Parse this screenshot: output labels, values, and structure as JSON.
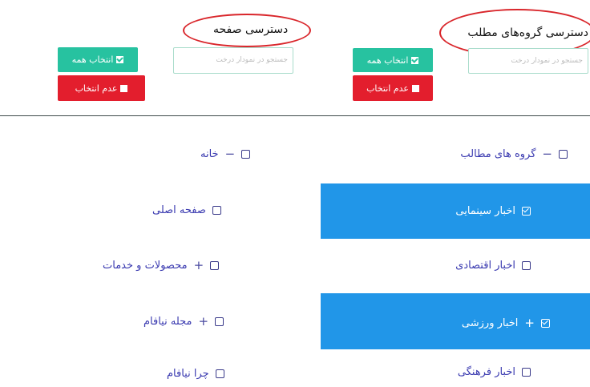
{
  "right_panel": {
    "title": "دسترسی گروه‌های مطلب",
    "search_placeholder": "جستجو در نمودار درخت",
    "select_all_label": "انتخاب همه",
    "deselect_label": "عدم انتخاب"
  },
  "left_panel": {
    "title": "دسترسی صفحه",
    "search_placeholder": "جستجو در نمودار درخت",
    "select_all_label": "انتخاب همه",
    "deselect_label": "عدم انتخاب"
  },
  "content_groups_tree": {
    "root": {
      "label": "گروه های مطالب",
      "toggle": "−"
    },
    "items": [
      {
        "label": "اخبار سینمایی",
        "checked": true,
        "highlighted": true,
        "toggle": ""
      },
      {
        "label": "اخبار اقتصادی",
        "checked": false,
        "highlighted": false,
        "toggle": ""
      },
      {
        "label": "اخبار ورزشی",
        "checked": true,
        "highlighted": true,
        "toggle": "+"
      },
      {
        "label": "اخبار فرهنگی",
        "checked": false,
        "highlighted": false,
        "toggle": ""
      }
    ]
  },
  "pages_tree": {
    "root": {
      "label": "خانه",
      "toggle": "−"
    },
    "items": [
      {
        "label": "صفحه اصلی",
        "toggle": ""
      },
      {
        "label": "محصولات و خدمات",
        "toggle": "+"
      },
      {
        "label": "مجله نیافام",
        "toggle": "+"
      },
      {
        "label": "چرا نیافام",
        "toggle": ""
      }
    ]
  },
  "colors": {
    "accent_blue": "#2196e8",
    "green": "#27c2a0",
    "red": "#e31e2d",
    "annotation_red": "#d9262b"
  }
}
